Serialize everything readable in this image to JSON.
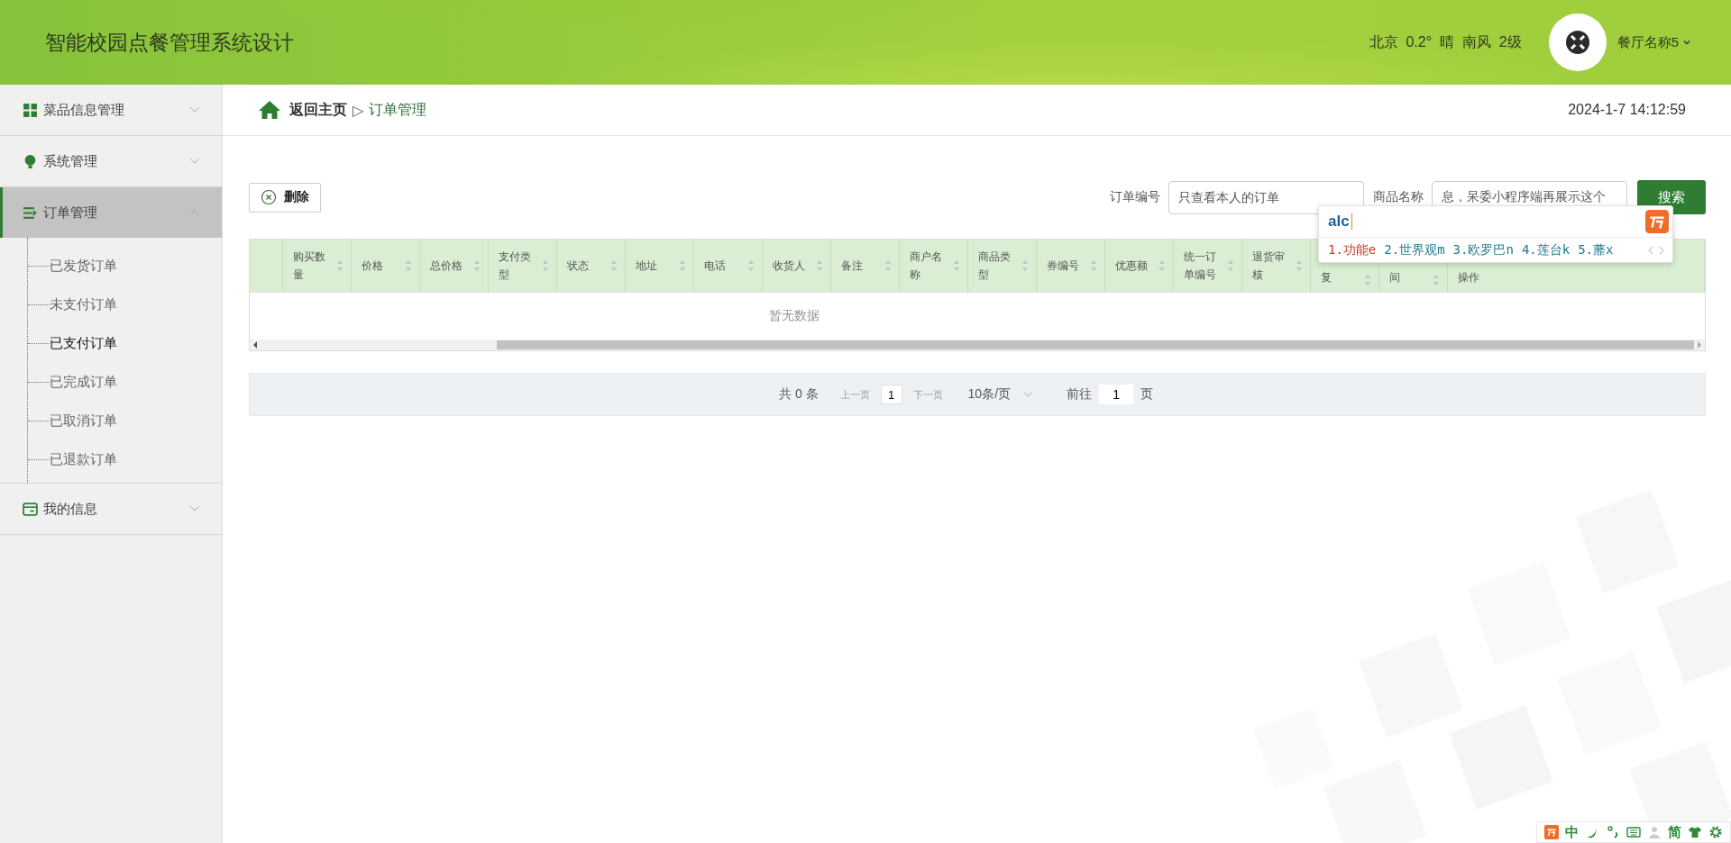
{
  "header": {
    "title": "智能校园点餐管理系统设计",
    "weather": "北京  0.2°  晴  南风  2级",
    "user": "餐厅名称5"
  },
  "sidebar": {
    "items": [
      {
        "label": "菜品信息管理",
        "expanded": false,
        "selected": false
      },
      {
        "label": "系统管理",
        "expanded": false,
        "selected": false
      },
      {
        "label": "订单管理",
        "expanded": true,
        "selected": true,
        "children": [
          {
            "label": "已发货订单",
            "selected": false
          },
          {
            "label": "未支付订单",
            "selected": false
          },
          {
            "label": "已支付订单",
            "selected": true
          },
          {
            "label": "已完成订单",
            "selected": false
          },
          {
            "label": "已取消订单",
            "selected": false
          },
          {
            "label": "已退款订单",
            "selected": false
          }
        ]
      },
      {
        "label": "我的信息",
        "expanded": false,
        "selected": false
      }
    ]
  },
  "breadcrumb": {
    "home": "返回主页",
    "separator": "▷",
    "current": "订单管理",
    "datetime": "2024-1-7 14:12:59"
  },
  "toolbar": {
    "delete_button": "删除",
    "filters": [
      {
        "label": "订单编号",
        "placeholder": "只查看本人的订单"
      },
      {
        "label": "商品名称",
        "value": "息，呆委小程序端再展示这个"
      }
    ],
    "search_button": "搜索"
  },
  "table": {
    "columns": [
      {
        "kind": "selection"
      },
      {
        "label": "购买数量",
        "kind": "normal",
        "sortable": true
      },
      {
        "label": "价格",
        "kind": "normal",
        "sortable": true
      },
      {
        "label": "总价格",
        "kind": "normal",
        "sortable": true
      },
      {
        "label": "支付类型",
        "kind": "normal",
        "sortable": true
      },
      {
        "label": "状态",
        "kind": "normal",
        "sortable": true
      },
      {
        "label": "地址",
        "kind": "normal",
        "sortable": true
      },
      {
        "label": "电话",
        "kind": "normal",
        "sortable": true
      },
      {
        "label": "收货人",
        "kind": "normal",
        "sortable": true
      },
      {
        "label": "备注",
        "kind": "normal",
        "sortable": true
      },
      {
        "label": "商户名称",
        "kind": "normal",
        "sortable": true
      },
      {
        "label": "商品类型",
        "kind": "normal",
        "sortable": true
      },
      {
        "label": "券编号",
        "kind": "normal",
        "sortable": true
      },
      {
        "label": "优惠额",
        "kind": "normal",
        "sortable": true
      },
      {
        "label": "统一订单编号",
        "kind": "normal",
        "sortable": true
      },
      {
        "label": "退货审核",
        "kind": "normal",
        "sortable": true
      },
      {
        "label": "复",
        "kind": "covered",
        "sortable": true
      },
      {
        "label": "间",
        "kind": "covered",
        "sortable": true
      },
      {
        "label": "操作",
        "kind": "covered",
        "sortable": false
      }
    ],
    "empty_text": "暂无数据"
  },
  "pagination": {
    "total": "共 0 条",
    "prev": "上一页",
    "page": "1",
    "next": "下一页",
    "page_size": "10条/页",
    "goto_label": "前往",
    "goto_value": "1",
    "goto_suffix": "页"
  },
  "ime_popup": {
    "composition": "alc",
    "candidates": [
      {
        "text": "1.功能e",
        "selected": true
      },
      {
        "text": "2.世界观m",
        "selected": false
      },
      {
        "text": "3.欧罗巴n",
        "selected": false
      },
      {
        "text": "4.莲台k",
        "selected": false
      },
      {
        "text": "5.蘼x",
        "selected": false
      }
    ]
  },
  "ime_toolbar": {
    "mode": "中",
    "script": "简"
  }
}
